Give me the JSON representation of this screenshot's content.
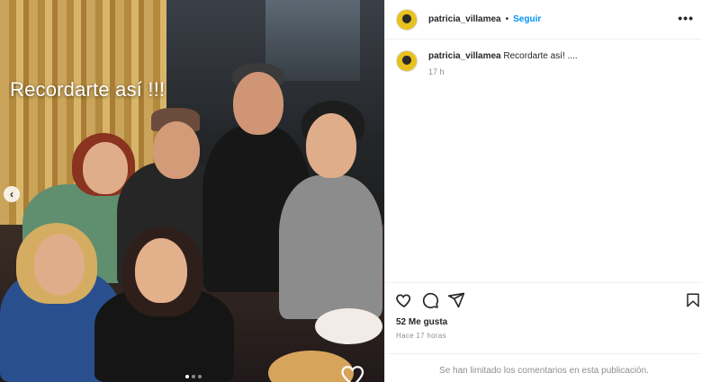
{
  "post": {
    "username": "patricia_villamea",
    "separator": "•",
    "follow_label": "Seguir",
    "more_label": "•••",
    "caption_user": "patricia_villamea",
    "caption_text": "Recordarte así! ....",
    "caption_time": "17 h",
    "likes": "52 Me gusta",
    "posted_ago": "Hace 17 horas",
    "comments_limited": "Se han limitado los comentarios en esta publicación."
  },
  "photo": {
    "overlay_text": "Recordarte así !!!",
    "prev_arrow": "‹",
    "carousel": {
      "count": 3,
      "active_index": 0
    }
  },
  "icons": {
    "like": "heart-icon",
    "comment": "comment-icon",
    "share": "share-icon",
    "save": "bookmark-icon",
    "photo_like": "heart-icon"
  },
  "colors": {
    "accent": "#0095f6",
    "muted": "#8e8e8e",
    "text": "#262626",
    "divider": "#efefef"
  }
}
